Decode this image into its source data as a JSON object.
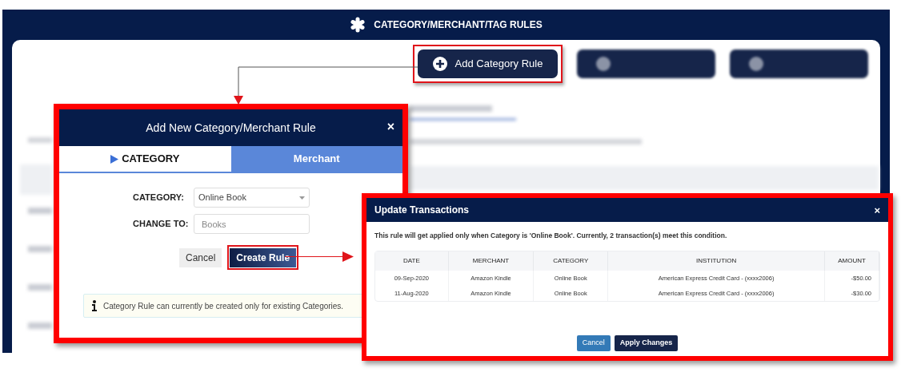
{
  "header": {
    "title": "CATEGORY/MERCHANT/TAG RULES"
  },
  "top_buttons": [
    {
      "label": "Add Category Rule",
      "highlighted": true
    }
  ],
  "rule_dialog": {
    "title": "Add New Category/Merchant Rule",
    "close": "×",
    "tabs": [
      {
        "label": "CATEGORY",
        "selected": true
      },
      {
        "label": "Merchant",
        "selected": false
      }
    ],
    "fields": [
      {
        "kind": "select",
        "label": "CATEGORY:",
        "value": "Online Book"
      },
      {
        "kind": "input",
        "label": "CHANGE TO:",
        "placeholder": "Books"
      }
    ],
    "buttons": [
      {
        "kind": "secondary",
        "label": "Cancel",
        "highlighted": false
      },
      {
        "kind": "primary",
        "label": "Create Rule",
        "highlighted": true
      }
    ],
    "info": "Category Rule can currently be created only for existing Categories."
  },
  "update_dialog": {
    "title": "Update Transactions",
    "close": "×",
    "message": "This rule will get applied only when Category is 'Online Book'. Currently, 2 transaction(s) meet this condition.",
    "table": {
      "columns": [
        "DATE",
        "MERCHANT",
        "CATEGORY",
        "INSTITUTION",
        "AMOUNT"
      ],
      "rows": [
        [
          "09-Sep-2020",
          "Amazon Kindle",
          "Online Book",
          "American Express Credit Card - (xxxx2006)",
          "-$50.00"
        ],
        [
          "11-Aug-2020",
          "Amazon Kindle",
          "Online Book",
          "American Express Credit Card - (xxxx2006)",
          "-$30.00"
        ]
      ]
    },
    "buttons": [
      {
        "kind": "secondary",
        "label": "Cancel"
      },
      {
        "kind": "primary",
        "label": "Apply Changes"
      }
    ]
  }
}
